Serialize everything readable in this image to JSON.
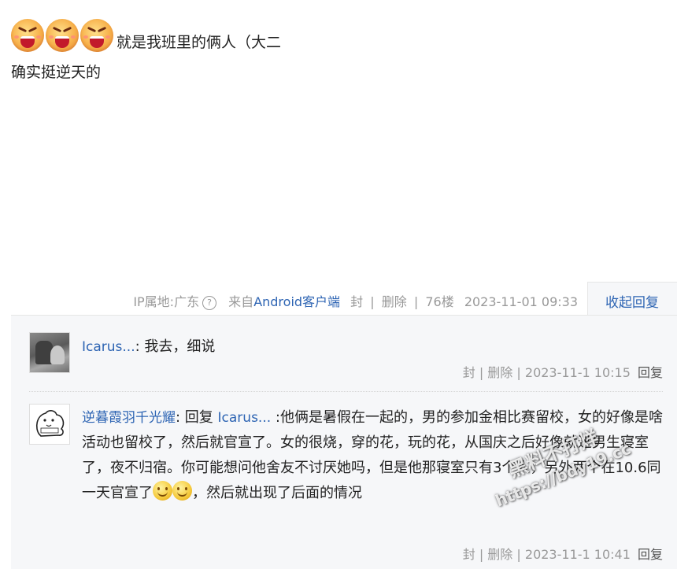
{
  "post": {
    "emojis": [
      "grimace-emoji",
      "grimace-emoji",
      "grimace-emoji"
    ],
    "line1": "就是我班里的俩人（大二",
    "line2": "确实挺逆天的"
  },
  "meta": {
    "ip_label": "IP属地:广东",
    "source_prefix": "来自",
    "source_link": "Android客户端",
    "seal": "封",
    "delete": "删除",
    "floor": "76楼",
    "time": "2023-11-01 09:33",
    "collapse": "收起回复",
    "sep": "|"
  },
  "replies": [
    {
      "user": "Icarus...",
      "text": ":  我去，细说",
      "meta": {
        "seal": "封",
        "delete": "删除",
        "time": "2023-11-1 10:15",
        "reply": "回复"
      }
    },
    {
      "user": "逆暮霞羽千光耀",
      "reply_prefix": ": 回复",
      "reply_to": "Icarus...",
      "text1": ":他俩是暑假在一起的，男的参加金相比赛留校，女的好像是啥活动也留校了，然后就官宣了。女的很烧，穿的花，玩的花，从国庆之后好像就进男生寝室了，夜不归宿。你可能想问他舍友不讨厌她吗，但是他那寝室只有3个人，另外两个在10.6同一天官宣了",
      "text2": "，然后就出现了后面的情况",
      "meta": {
        "seal": "封",
        "delete": "删除",
        "time": "2023-11-1 10:41",
        "reply": "回复"
      }
    }
  ],
  "watermark": {
    "line1": "黑料不打烊",
    "line2": "https://bdy19.cc"
  }
}
